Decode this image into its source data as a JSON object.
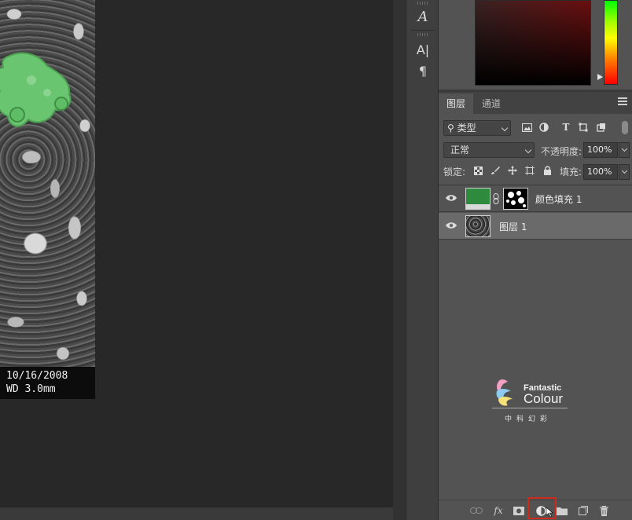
{
  "canvas": {
    "sem_caption_line1": "10/16/2008",
    "sem_caption_line2": "WD 3.0mm"
  },
  "tool_strip": {
    "tools": [
      {
        "name": "character-panel",
        "glyph": "𝐴"
      },
      {
        "name": "character-styles",
        "glyph": "A|"
      },
      {
        "name": "paragraph-panel",
        "glyph": "¶"
      }
    ]
  },
  "layers_panel": {
    "tabs": [
      "图层",
      "通道"
    ],
    "filter": {
      "label": "类型"
    },
    "blend_mode": "正常",
    "opacity_label": "不透明度:",
    "opacity_value": "100%",
    "lock_label": "锁定:",
    "fill_label": "填充:",
    "fill_value": "100%",
    "layers": [
      {
        "name": "颜色填充 1",
        "color": "#2e8b3d",
        "selected": false
      },
      {
        "name": "图层 1",
        "selected": true
      }
    ]
  },
  "watermark": {
    "line1": "Fantastic",
    "line2": "Colour",
    "line3": "中科幻彩"
  },
  "colors": {
    "fill_swatch": "#2e8b3d",
    "highlight": "#d02a1a",
    "panel_bg": "#535353"
  },
  "bottom_bar": {
    "icons": [
      "link-layers-icon",
      "fx-icon",
      "add-mask-icon",
      "adjustment-layer-icon",
      "new-group-icon",
      "new-layer-icon",
      "delete-layer-icon"
    ],
    "fx_label": "fx"
  }
}
